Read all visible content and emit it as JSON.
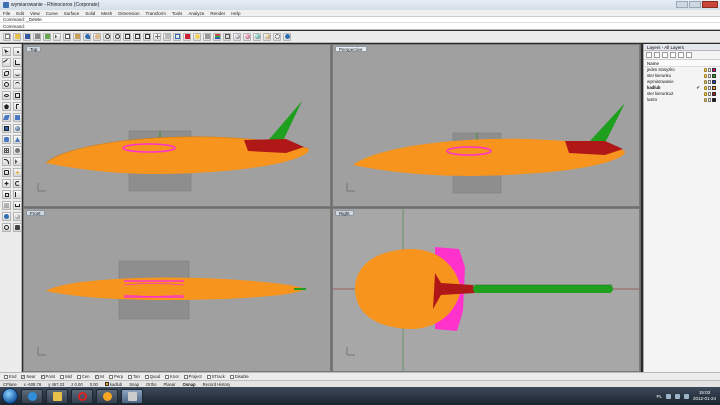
{
  "window": {
    "title": "wymiarowanie - Rhinoceros (Corporate)"
  },
  "menu": [
    "File",
    "Edit",
    "View",
    "Curve",
    "Surface",
    "Solid",
    "Mesh",
    "Dimension",
    "Transform",
    "Tools",
    "Analyze",
    "Render",
    "Help"
  ],
  "command": {
    "history": "Command: _Delete",
    "prompt": "Command:"
  },
  "viewports": {
    "top": {
      "label": "Top"
    },
    "perspective": {
      "label": "Perspective"
    },
    "front": {
      "label": "Front"
    },
    "right": {
      "label": "Right"
    }
  },
  "layers_panel": {
    "title": "Layers - All Layers",
    "header": "Name",
    "rows": [
      {
        "name": "jeden stosyzko",
        "color": "#e6007e"
      },
      {
        "name": "ster kierunku",
        "color": "#1e9f1e"
      },
      {
        "name": "wymiarowanie",
        "color": "#2040c0"
      },
      {
        "name": "kadlub",
        "color": "#f7a12b",
        "current": true,
        "check": "✔"
      },
      {
        "name": "ster kierunku2",
        "color": "#b01818"
      },
      {
        "name": "lustro",
        "color": "#111111"
      }
    ]
  },
  "osnaps": [
    {
      "label": "End",
      "checked": false
    },
    {
      "label": "Near",
      "checked": true
    },
    {
      "label": "Point",
      "checked": true
    },
    {
      "label": "Mid",
      "checked": false
    },
    {
      "label": "Cen",
      "checked": false
    },
    {
      "label": "Int",
      "checked": true
    },
    {
      "label": "Perp",
      "checked": false
    },
    {
      "label": "Tan",
      "checked": false
    },
    {
      "label": "Quad",
      "checked": false
    },
    {
      "label": "Knot",
      "checked": false
    },
    {
      "label": "Project",
      "checked": false
    },
    {
      "label": "STrack",
      "checked": false
    },
    {
      "label": "Disable",
      "checked": false
    }
  ],
  "status": {
    "cplane": "CPlane",
    "x": "x -608.76",
    "y": "y 467.23",
    "z": "z 0.00",
    "zero": "0.00",
    "layer": "kadlub",
    "snap": "Snap",
    "ortho": "Ortho",
    "planar": "Planar",
    "osnap": "Osnap",
    "history": "Record History"
  },
  "taskbar": {
    "lang": "PL",
    "time": "15:03",
    "date": "2012-01-24"
  },
  "colors": {
    "fuselage": "#f7941d",
    "canopy": "#ff33cc",
    "rudder": "#1e9f1e",
    "stabilizer": "#b01818"
  }
}
